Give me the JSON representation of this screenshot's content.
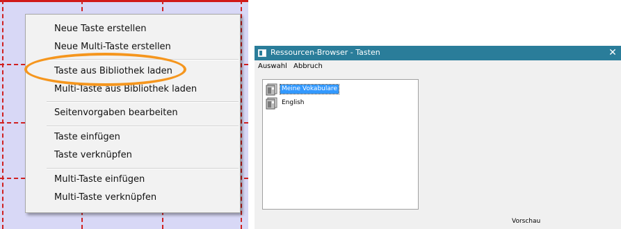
{
  "context_menu": {
    "items": [
      {
        "label": "Neue Taste erstellen"
      },
      {
        "label": "Neue Multi-Taste erstellen"
      },
      {
        "label": "Taste aus Bibliothek laden"
      },
      {
        "label": "Multi-Taste aus Bibliothek laden"
      },
      {
        "label": "Seitenvorgaben bearbeiten"
      },
      {
        "label": "Taste einfügen"
      },
      {
        "label": "Taste verknüpfen"
      },
      {
        "label": "Multi-Taste einfügen"
      },
      {
        "label": "Multi-Taste verknüpfen"
      }
    ]
  },
  "dialog": {
    "title": "Ressourcen-Browser - Tasten",
    "close_glyph": "✕",
    "menu": {
      "auswahl": "Auswahl",
      "abbruch": "Abbruch"
    },
    "tree": {
      "items": [
        {
          "label": "Meine Vokabulare",
          "selected": true,
          "icon": "resource-folder-icon"
        },
        {
          "label": "English",
          "selected": false,
          "icon": "resource-folder-icon"
        }
      ]
    },
    "preview_label": "Vorschau"
  },
  "colors": {
    "grid_background": "#d8d8f6",
    "grid_lines": "#d02020",
    "highlight_ellipse": "#f5961e",
    "titlebar": "#2a7d9a",
    "selection": "#3399ff"
  }
}
